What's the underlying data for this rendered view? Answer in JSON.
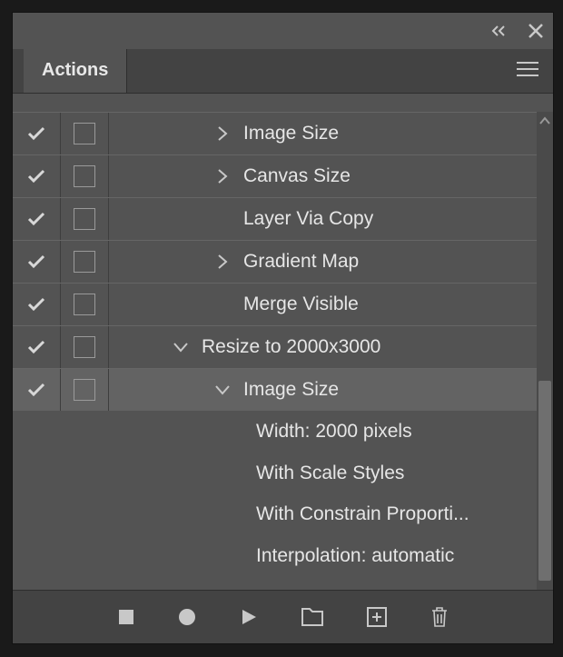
{
  "panel": {
    "title": "Actions"
  },
  "rows": [
    {
      "label": "Image Size",
      "indent": 1,
      "expand": "right",
      "checked": true,
      "dialog": true
    },
    {
      "label": "Canvas Size",
      "indent": 1,
      "expand": "right",
      "checked": true,
      "dialog": true
    },
    {
      "label": "Layer Via Copy",
      "indent": 1,
      "expand": "none",
      "checked": true,
      "dialog": true
    },
    {
      "label": "Gradient Map",
      "indent": 1,
      "expand": "right",
      "checked": true,
      "dialog": true
    },
    {
      "label": "Merge Visible",
      "indent": 1,
      "expand": "none",
      "checked": true,
      "dialog": true
    },
    {
      "label": "Resize to 2000x3000",
      "indent": 0,
      "expand": "down",
      "checked": true,
      "dialog": true
    },
    {
      "label": "Image Size",
      "indent": 1,
      "expand": "down",
      "checked": true,
      "dialog": true,
      "selected": true
    }
  ],
  "details": [
    "Width: 2000 pixels",
    "With Scale Styles",
    "With Constrain Proporti...",
    "Interpolation: automatic"
  ]
}
